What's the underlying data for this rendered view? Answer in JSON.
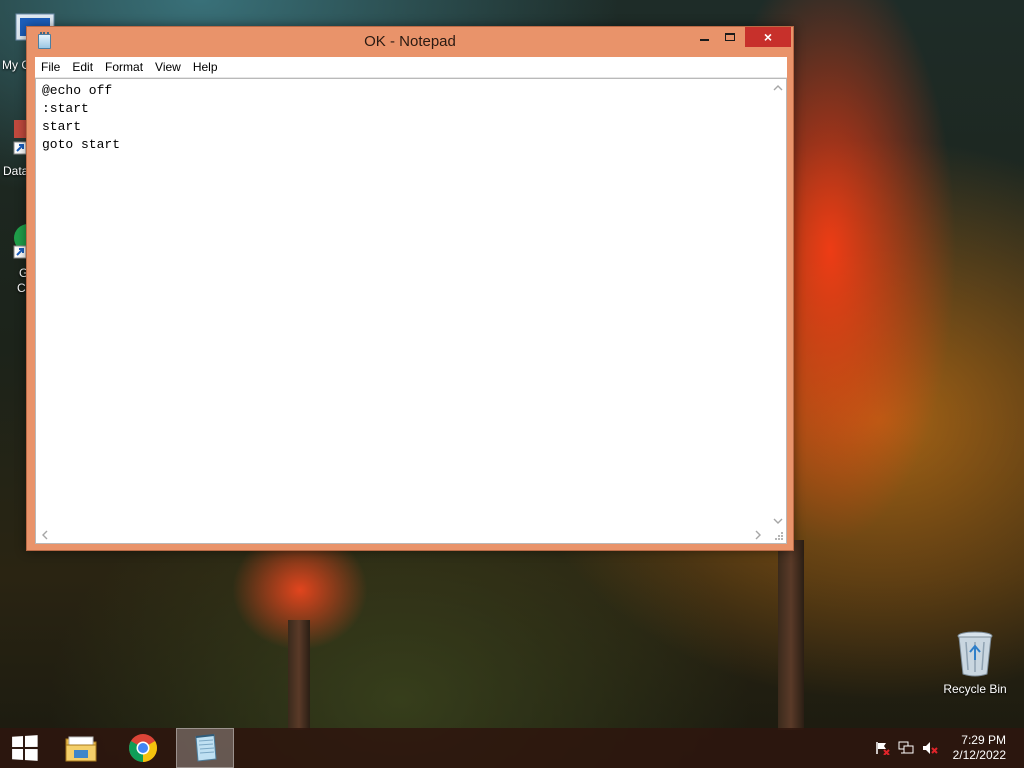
{
  "desktop": {
    "icons": [
      {
        "label": "My C"
      },
      {
        "label": "Data"
      },
      {
        "label": "G"
      },
      {
        "label": "C"
      },
      {
        "label": "Recycle Bin"
      }
    ]
  },
  "window": {
    "title": "OK - Notepad",
    "close_glyph": "×",
    "menu": [
      "File",
      "Edit",
      "Format",
      "View",
      "Help"
    ],
    "content_lines": [
      "@echo off",
      ":start",
      "start",
      "goto start"
    ]
  },
  "taskbar": {
    "time": "7:29 PM",
    "date": "2/12/2022",
    "pinned": [
      "windows-start-icon",
      "file-explorer-icon",
      "chrome-icon",
      "notepad-icon"
    ],
    "tray": [
      "action-center-flag-icon",
      "network-icon",
      "volume-muted-icon"
    ]
  },
  "colors": {
    "window_frame": "#e9936a",
    "close_button": "#c7302b",
    "taskbar": "#2e160e"
  }
}
